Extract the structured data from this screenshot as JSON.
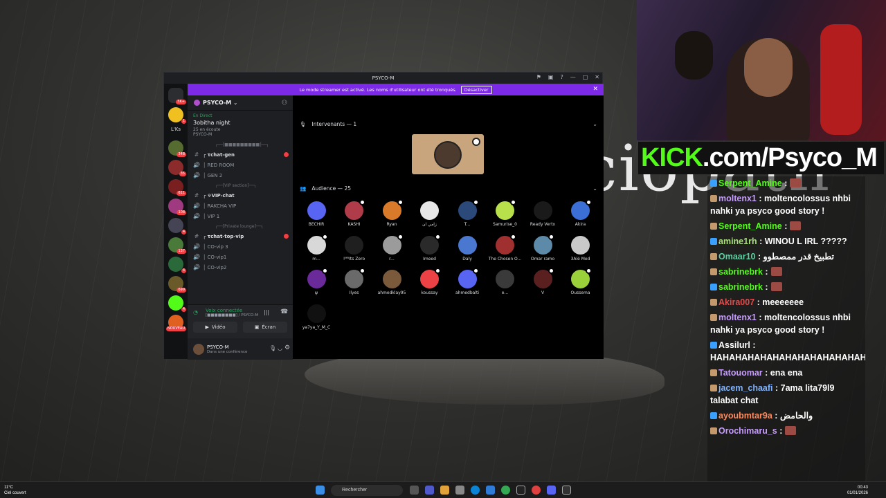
{
  "background": {
    "word": "ciopath"
  },
  "overlay": {
    "kick_logo": "KICK",
    "kick_url": ".com/Psyco_M"
  },
  "chat": [
    {
      "user": "Serpent_Amine",
      "color": "#53fc18",
      "text": ":",
      "emote": true
    },
    {
      "user": "moltenx1",
      "color": "#c79cff",
      "text": ": moltencolossus nhbi nahki ya psyco good story !",
      "emote": false
    },
    {
      "user": "Serpent_Amine",
      "color": "#53fc18",
      "text": ":",
      "emote": true
    },
    {
      "user": "amine1rh",
      "color": "#a9e07b",
      "text": ": WINOU L IRL ?????",
      "emote": false
    },
    {
      "user": "Omaar10",
      "color": "#5ad1a3",
      "text": ": تطبيخ قدر ممصطوو",
      "emote": false
    },
    {
      "user": "sabrinebrk",
      "color": "#53fc18",
      "text": ":",
      "emote": true
    },
    {
      "user": "sabrinebrk",
      "color": "#53fc18",
      "text": ":",
      "emote": true
    },
    {
      "user": "Akira007",
      "color": "#e04b4b",
      "text": ": meeeeeee",
      "emote": false
    },
    {
      "user": "moltenx1",
      "color": "#c79cff",
      "text": ": moltencolossus nhbi nahki ya psyco good story !",
      "emote": false
    },
    {
      "user": "Assilurl",
      "color": "#ffffff",
      "text": ": HAHAHAHAHAHAHAHAHAHAHAHAHAHAHAHAHAHAHAHAHAHAHAHAHAHAHAHAHAHAHAHAHAHAHAHAHAHAHAHAHAHAHAHAHAHAHAHAHAHAHAHHAHAHAHHHAHAHA",
      "emote": false
    },
    {
      "user": "Tatouomar",
      "color": "#c79cff",
      "text": ": ena ena",
      "emote": false
    },
    {
      "user": "jacem_chaafi",
      "color": "#7fb3ff",
      "text": ": 7ama lita79l9 talabat chat",
      "emote": false
    },
    {
      "user": "ayoubmtar9a",
      "color": "#ff8a5c",
      "text": ": والحامض",
      "emote": false
    },
    {
      "user": "Orochimaru_s",
      "color": "#c79cff",
      "text": ":",
      "emote": true
    }
  ],
  "discord": {
    "window_title": "PSYCO-M",
    "streamer_notice": "Le mode streamer est activé. Les noms d'utilisateur ont été tronqués.",
    "streamer_button": "Désactiver",
    "guild_name": "PSYCO-M",
    "live_label": "En Direct",
    "event_title": "3obitha night",
    "event_listeners": "25 en écoute",
    "event_host": "PSYCO-M",
    "server_badges": [
      "5K+",
      "1",
      "",
      "348",
      "35",
      "611",
      "108",
      "4",
      "137",
      "4",
      "699",
      "4",
      "NOUVEAU"
    ],
    "server_label": "L'Ks",
    "channels": [
      {
        "type": "cat",
        "label": "┌──[■■■■■■■■■]──┐"
      },
      {
        "type": "text",
        "label": "┌ τchat-gen",
        "badge": true
      },
      {
        "type": "voice",
        "label": "│ RED ROOM"
      },
      {
        "type": "voice",
        "label": "│ GEN 2"
      },
      {
        "type": "cat",
        "label": "┌──[VIP section]──┐"
      },
      {
        "type": "text",
        "label": "┌ ✞VIP-chat",
        "badge": false
      },
      {
        "type": "voice",
        "label": "│ RAKCHA VIP"
      },
      {
        "type": "voice",
        "label": "│ VIP 1"
      },
      {
        "type": "cat",
        "label": "┌──[Private lounge]──┐"
      },
      {
        "type": "text",
        "label": "┌ τchat-top-vip",
        "badge": true
      },
      {
        "type": "voice",
        "label": "│ CO-vip 3"
      },
      {
        "type": "voice",
        "label": "│ CO-vip1"
      },
      {
        "type": "voice",
        "label": "│ CO-vip2"
      }
    ],
    "voice": {
      "status": "Voix connectée",
      "channel": "[■■■■■■■■] / PSYCO-M",
      "video": "Vidéo",
      "screen": "Écran"
    },
    "user": {
      "name": "PSYCO-M",
      "status": "Dans une conférence"
    },
    "speakers_header": "Intervenants — 1",
    "audience_header": "Audience — 25",
    "audience": [
      {
        "name": "BECHIR",
        "color": "#5865f2"
      },
      {
        "name": "KASHI",
        "color": "#b03c4a"
      },
      {
        "name": "Ryan",
        "color": "#d97a2b"
      },
      {
        "name": "زامي ان",
        "color": "#e8e8e8"
      },
      {
        "name": "T...",
        "color": "#2b4a7a"
      },
      {
        "name": "Samurise_0",
        "color": "#b8e04a"
      },
      {
        "name": "Ready Vertx",
        "color": "#1a1a1a"
      },
      {
        "name": "Akira",
        "color": "#3b6fd6"
      },
      {
        "name": "m...",
        "color": "#d8d8d8"
      },
      {
        "name": "!ᴹᴿIts Zero",
        "color": "#1f1f1f"
      },
      {
        "name": "r...",
        "color": "#9b9b9b"
      },
      {
        "name": "Imeed",
        "color": "#2a2a2a"
      },
      {
        "name": "Daly",
        "color": "#4a78d0"
      },
      {
        "name": "The Chosen O...",
        "color": "#a03030"
      },
      {
        "name": "Omar ramo",
        "color": "#5c8aa8"
      },
      {
        "name": "3Alé Med",
        "color": "#c9c9c9"
      },
      {
        "name": "ψ",
        "color": "#6a2a9a"
      },
      {
        "name": "Ilyes",
        "color": "#6a6a6a"
      },
      {
        "name": "ahmedklay95",
        "color": "#7a5a3a"
      },
      {
        "name": "koussay",
        "color": "#ed4245"
      },
      {
        "name": "ahmedbalti",
        "color": "#5865f2"
      },
      {
        "name": "e...",
        "color": "#3a3a3a"
      },
      {
        "name": "V",
        "color": "#5a2020"
      },
      {
        "name": "Oussema",
        "color": "#9ad03a"
      },
      {
        "name": "ya7ya_Y_M_C",
        "color": "#111111"
      }
    ]
  },
  "taskbar": {
    "weather_temp": "11°C",
    "weather_desc": "Ciel couvert",
    "search": "Rechercher",
    "time": "00:43",
    "date": "01/01/2026"
  }
}
